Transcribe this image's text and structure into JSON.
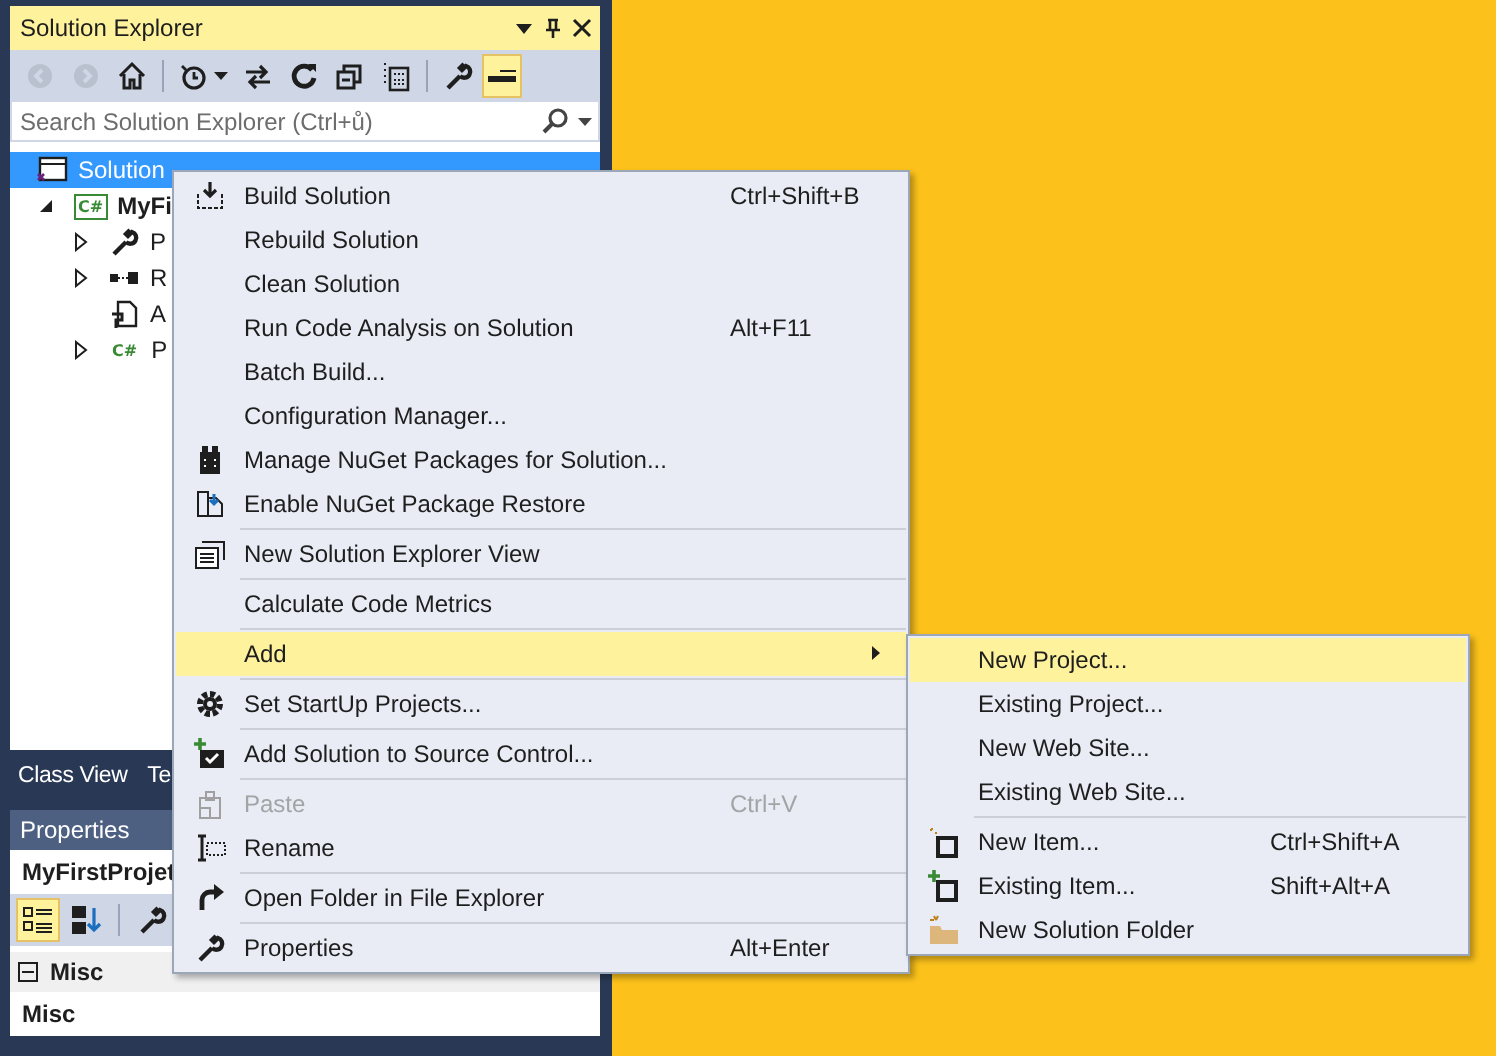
{
  "solution_explorer": {
    "title": "Solution Explorer",
    "toolbar": [
      {
        "disabled": true,
        "selected": false
      },
      {
        "disabled": true,
        "selected": false
      },
      {
        "disabled": false,
        "selected": false
      },
      {
        "disabled": false,
        "selected": false
      },
      {
        "disabled": false,
        "selected": false
      },
      {
        "disabled": false,
        "selected": false
      },
      {
        "disabled": false,
        "selected": false
      },
      {
        "disabled": false,
        "selected": false
      },
      {
        "disabled": false,
        "selected": false
      },
      {
        "disabled": false,
        "selected": true
      }
    ],
    "search": {
      "placeholder": "Search Solution Explorer (Ctrl+ů)"
    },
    "tree": [
      {
        "kind": "solution",
        "label": "Solution",
        "selected": true,
        "children": [
          {
            "kind": "project",
            "label": "MyFi",
            "badge": "C#",
            "expanded": true,
            "selected": false,
            "children": [
              {
                "kind": "properties",
                "label": "P",
                "expanded": false,
                "selected": false
              },
              {
                "kind": "references",
                "label": "R",
                "expanded": false,
                "selected": false
              },
              {
                "kind": "config",
                "label": "A",
                "selected": false
              },
              {
                "kind": "class",
                "label": "P",
                "badge": "C#",
                "expanded": false,
                "selected": false
              }
            ]
          }
        ]
      }
    ]
  },
  "tabs": [
    {
      "label": "Class View",
      "selected": false
    },
    {
      "label": "Te",
      "selected": false
    }
  ],
  "properties": {
    "title": "Properties",
    "object": "MyFirstProjet",
    "toolbar": [
      {
        "selected": true
      },
      {
        "selected": false
      },
      {
        "selected": false
      }
    ],
    "categories": [
      {
        "label": "Misc",
        "expanded": true,
        "rows": [
          {
            "label": "Misc"
          }
        ]
      }
    ]
  },
  "context_menu": {
    "items": [
      {
        "kind": "item",
        "label": "Build Solution",
        "shortcut": "Ctrl+Shift+B",
        "disabled": false,
        "selected": false,
        "submenu": false
      },
      {
        "kind": "item",
        "label": "Rebuild Solution",
        "disabled": false,
        "selected": false,
        "submenu": false
      },
      {
        "kind": "item",
        "label": "Clean Solution",
        "disabled": false,
        "selected": false,
        "submenu": false
      },
      {
        "kind": "item",
        "label": "Run Code Analysis on Solution",
        "shortcut": "Alt+F11",
        "disabled": false,
        "selected": false,
        "submenu": false
      },
      {
        "kind": "item",
        "label": "Batch Build...",
        "disabled": false,
        "selected": false,
        "submenu": false
      },
      {
        "kind": "item",
        "label": "Configuration Manager...",
        "disabled": false,
        "selected": false,
        "submenu": false
      },
      {
        "kind": "item",
        "label": "Manage NuGet Packages for Solution...",
        "disabled": false,
        "selected": false,
        "submenu": false
      },
      {
        "kind": "item",
        "label": "Enable NuGet Package Restore",
        "disabled": false,
        "selected": false,
        "submenu": false
      },
      {
        "kind": "separator"
      },
      {
        "kind": "item",
        "label": "New Solution Explorer View",
        "disabled": false,
        "selected": false,
        "submenu": false
      },
      {
        "kind": "separator"
      },
      {
        "kind": "item",
        "label": "Calculate Code Metrics",
        "disabled": false,
        "selected": false,
        "submenu": false
      },
      {
        "kind": "separator"
      },
      {
        "kind": "item",
        "label": "Add",
        "disabled": false,
        "selected": true,
        "submenu": true
      },
      {
        "kind": "separator"
      },
      {
        "kind": "item",
        "label": "Set StartUp Projects...",
        "disabled": false,
        "selected": false,
        "submenu": false
      },
      {
        "kind": "separator"
      },
      {
        "kind": "item",
        "label": "Add Solution to Source Control...",
        "disabled": false,
        "selected": false,
        "submenu": false
      },
      {
        "kind": "separator"
      },
      {
        "kind": "item",
        "label": "Paste",
        "shortcut": "Ctrl+V",
        "disabled": true,
        "selected": false,
        "submenu": false
      },
      {
        "kind": "item",
        "label": "Rename",
        "disabled": false,
        "selected": false,
        "submenu": false
      },
      {
        "kind": "separator"
      },
      {
        "kind": "item",
        "label": "Open Folder in File Explorer",
        "disabled": false,
        "selected": false,
        "submenu": false
      },
      {
        "kind": "separator"
      },
      {
        "kind": "item",
        "label": "Properties",
        "shortcut": "Alt+Enter",
        "disabled": false,
        "selected": false,
        "submenu": false
      }
    ]
  },
  "add_submenu": {
    "items": [
      {
        "kind": "item",
        "label": "New Project...",
        "disabled": false,
        "selected": true,
        "submenu": false
      },
      {
        "kind": "item",
        "label": "Existing Project...",
        "disabled": false,
        "selected": false,
        "submenu": false
      },
      {
        "kind": "item",
        "label": "New Web Site...",
        "disabled": false,
        "selected": false,
        "submenu": false
      },
      {
        "kind": "item",
        "label": "Existing Web Site...",
        "disabled": false,
        "selected": false,
        "submenu": false
      },
      {
        "kind": "separator"
      },
      {
        "kind": "item",
        "label": "New Item...",
        "shortcut": "Ctrl+Shift+A",
        "disabled": false,
        "selected": false,
        "submenu": false
      },
      {
        "kind": "item",
        "label": "Existing Item...",
        "shortcut": "Shift+Alt+A",
        "disabled": false,
        "selected": false,
        "submenu": false
      },
      {
        "kind": "item",
        "label": "New Solution Folder",
        "disabled": false,
        "selected": false,
        "submenu": false
      }
    ]
  }
}
